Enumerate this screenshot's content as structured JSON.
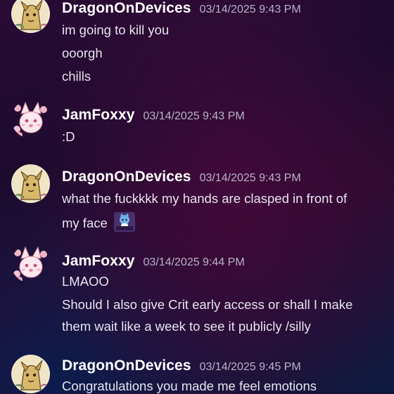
{
  "messages": [
    {
      "user": "DragonOnDevices",
      "timestamp": "03/14/2025 9:43 PM",
      "lines": [
        "im going to kill you",
        "ooorgh",
        "chills"
      ]
    },
    {
      "user": "JamFoxxy",
      "timestamp": "03/14/2025 9:43 PM",
      "lines": [
        ":D"
      ]
    },
    {
      "user": "DragonOnDevices",
      "timestamp": "03/14/2025 9:43 PM",
      "lines": [
        "what the fuckkkk my hands are clasped in front of",
        "my face"
      ],
      "emoji": "crying-kitten-emoji"
    },
    {
      "user": "JamFoxxy",
      "timestamp": "03/14/2025 9:44 PM",
      "lines": [
        "LMAOO",
        "Should I also give Crit early access or shall I make",
        "them wait like a week to see it publicly /silly"
      ]
    },
    {
      "user": "DragonOnDevices",
      "timestamp": "03/14/2025 9:45 PM",
      "lines": [
        "Congratulations you made me feel emotions"
      ]
    }
  ],
  "colors": {
    "username": "#ffffff",
    "timestamp": "#b8b2c8",
    "text": "#e6e3ef"
  },
  "icons": {
    "dragon_avatar": "dragon-avatar",
    "fox_avatar": "fox-avatar"
  }
}
